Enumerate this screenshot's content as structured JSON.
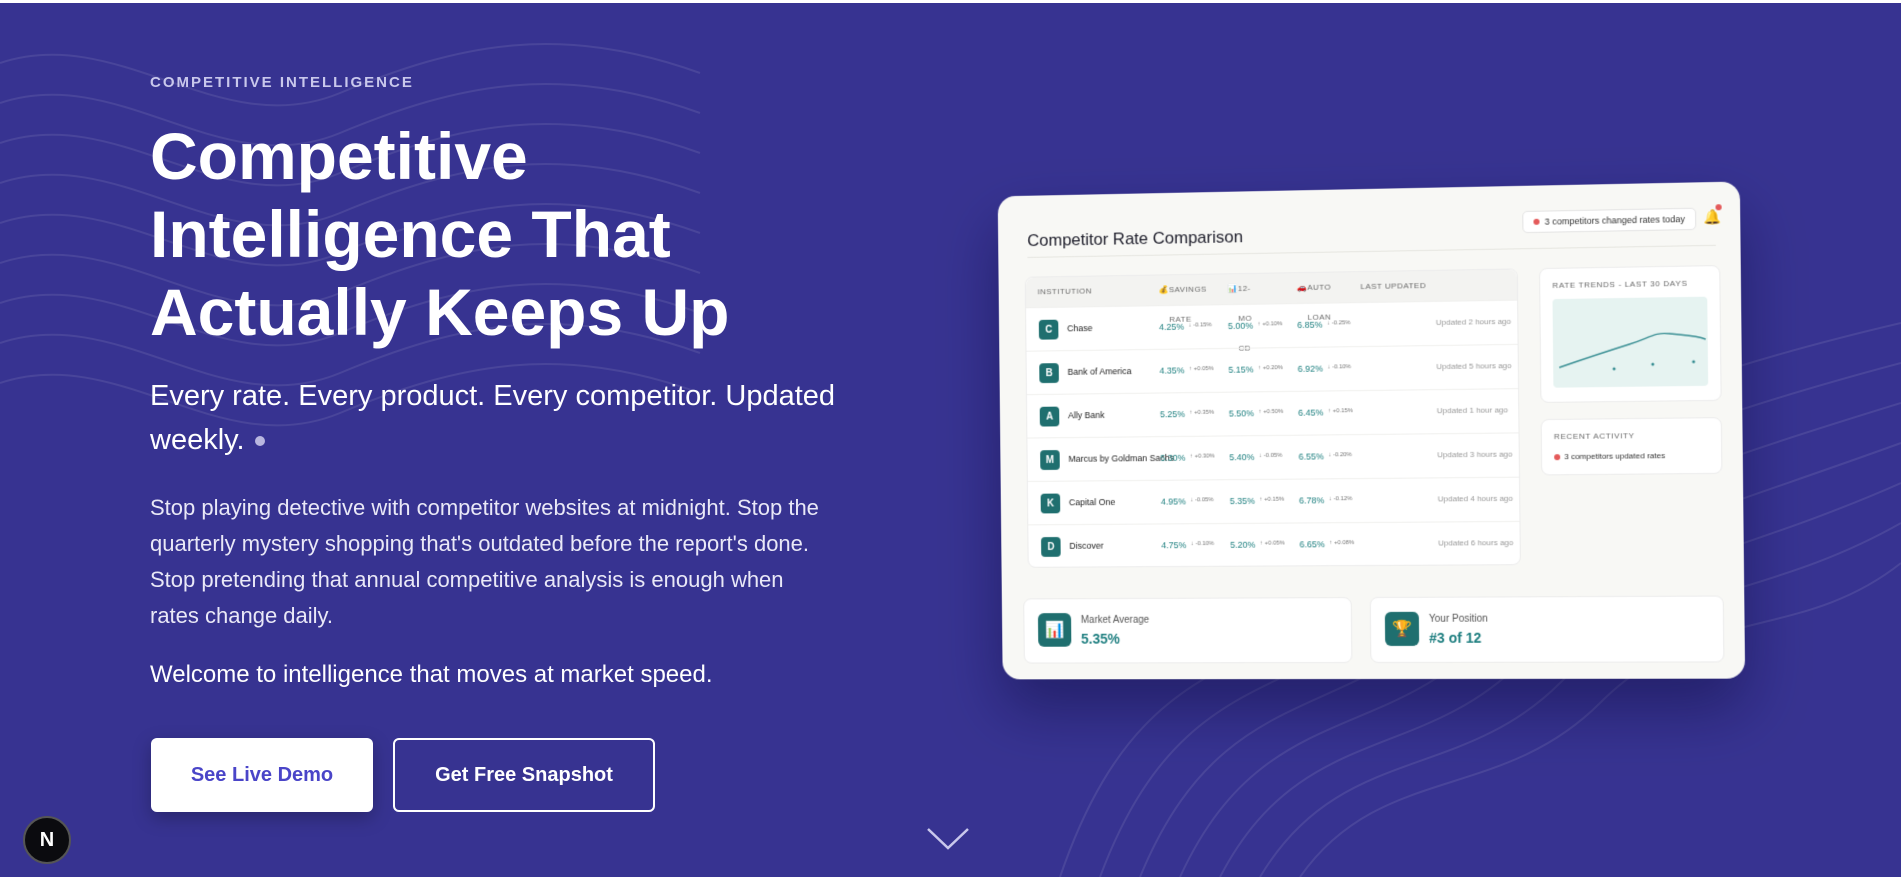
{
  "hero": {
    "eyebrow": "COMPETITIVE INTELLIGENCE",
    "headline": [
      "Competitive",
      "Intelligence That",
      "Actually Keeps Up"
    ],
    "subhead": "Every rate. Every product. Every competitor. Updated weekly.",
    "body": "Stop playing detective with competitor websites at midnight. Stop the quarterly mystery shopping that's outdated before the report's done. Stop pretending that annual competitive analysis is enough when rates change daily.",
    "closing": "Welcome to intelligence that moves at market speed.",
    "primary_cta": "See Live Demo",
    "secondary_cta": "Get Free Snapshot",
    "scroll_icon": "chevron-down-icon",
    "badge_letter": "N"
  },
  "colors": {
    "background": "#373391",
    "primary_button_text": "#4a45c8",
    "accent_teal": "#1f7f80",
    "alert_red": "#e45a5a"
  },
  "mockup": {
    "title": "Competitor Rate Comparison",
    "alert": "3 competitors changed rates today",
    "bell_icon": "bell-icon",
    "columns": {
      "institution": "INSTITUTION",
      "savings": "SAVINGS RATE",
      "cd": "12-MO CD",
      "auto": "AUTO LOAN",
      "updated": "LAST UPDATED"
    },
    "rows": [
      {
        "initial": "C",
        "name": "Chase",
        "savings": "4.25%",
        "savings_chg": "↓ -0.15%",
        "cd": "5.00%",
        "cd_chg": "↑ +0.10%",
        "auto": "6.85%",
        "auto_chg": "↓ -0.25%",
        "updated": "Updated 2 hours ago"
      },
      {
        "initial": "B",
        "name": "Bank of America",
        "savings": "4.35%",
        "savings_chg": "↑ +0.05%",
        "cd": "5.15%",
        "cd_chg": "↑ +0.20%",
        "auto": "6.92%",
        "auto_chg": "↓ -0.10%",
        "updated": "Updated 5 hours ago"
      },
      {
        "initial": "A",
        "name": "Ally Bank",
        "savings": "5.25%",
        "savings_chg": "↑ +0.35%",
        "cd": "5.50%",
        "cd_chg": "↑ +0.50%",
        "auto": "6.45%",
        "auto_chg": "↑ +0.15%",
        "updated": "Updated 1 hour ago"
      },
      {
        "initial": "M",
        "name": "Marcus by Goldman Sachs",
        "savings": "5.30%",
        "savings_chg": "↑ +0.30%",
        "cd": "5.40%",
        "cd_chg": "↓ -0.05%",
        "auto": "6.55%",
        "auto_chg": "↓ -0.20%",
        "updated": "Updated 3 hours ago"
      },
      {
        "initial": "K",
        "name": "Capital One",
        "savings": "4.95%",
        "savings_chg": "↓ -0.05%",
        "cd": "5.35%",
        "cd_chg": "↑ +0.15%",
        "auto": "6.78%",
        "auto_chg": "↓ -0.12%",
        "updated": "Updated 4 hours ago"
      },
      {
        "initial": "D",
        "name": "Discover",
        "savings": "4.75%",
        "savings_chg": "↓ -0.10%",
        "cd": "5.20%",
        "cd_chg": "↑ +0.05%",
        "auto": "6.65%",
        "auto_chg": "↑ +0.08%",
        "updated": "Updated 6 hours ago"
      }
    ],
    "trends_title": "RATE TRENDS - LAST 30 DAYS",
    "activity_title": "RECENT ACTIVITY",
    "activity_item": "3 competitors updated rates",
    "market_avg_label": "Market Average",
    "market_avg_value": "5.35%",
    "market_avg_icon": "bar-chart-icon",
    "position_label": "Your Position",
    "position_value": "#3 of 12",
    "position_icon": "trophy-icon"
  }
}
